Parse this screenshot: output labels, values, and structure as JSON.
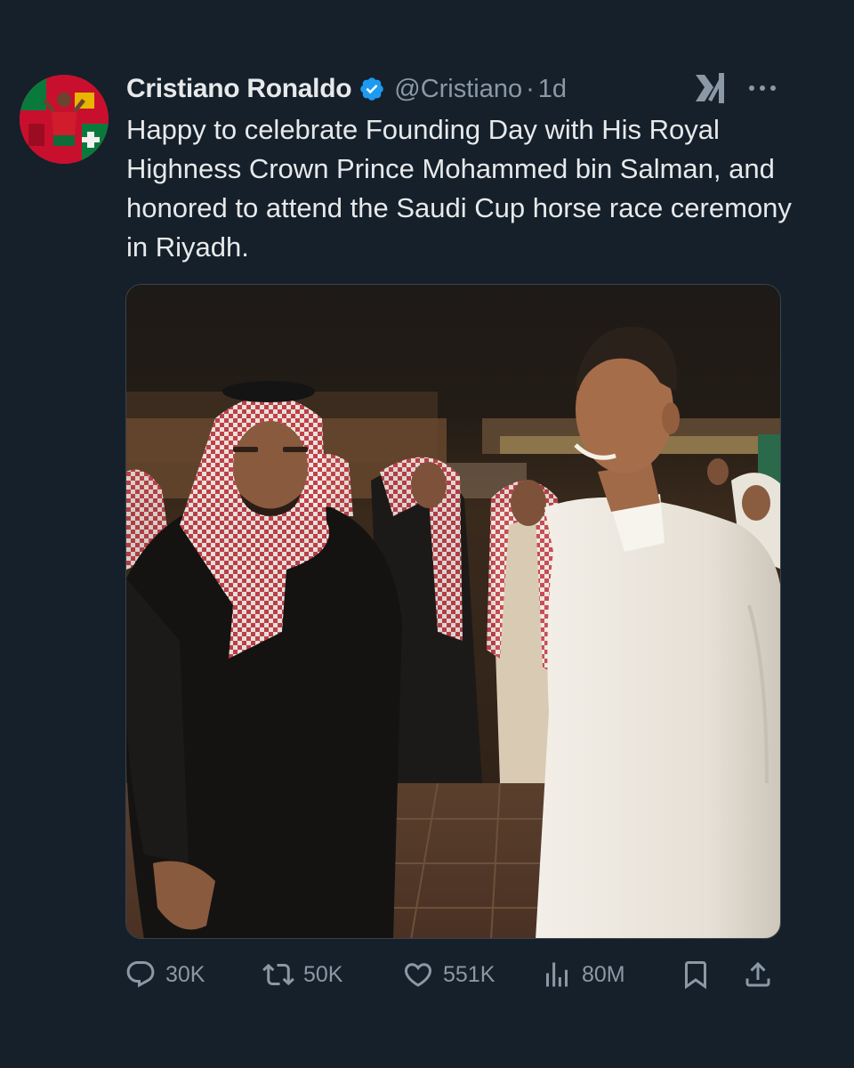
{
  "author": {
    "display_name": "Cristiano Ronaldo",
    "handle": "@Cristiano",
    "separator": "·",
    "time": "1d",
    "verified_icon": "verified-badge-icon",
    "avatar_colors": {
      "primary": "#c8102e",
      "secondary": "#0a7a3c",
      "accent": "#e8b600"
    }
  },
  "tweet": {
    "text": "Happy to celebrate Founding Day with His Royal Highness Crown Prince Mohammed bin Salman, and honored to attend the Saudi Cup horse race ceremony in Riyadh."
  },
  "media": {
    "icon": "photo-image"
  },
  "actions": {
    "reply": {
      "icon": "reply-icon",
      "count": "30K"
    },
    "retweet": {
      "icon": "retweet-icon",
      "count": "50K"
    },
    "like": {
      "icon": "like-icon",
      "count": "551K"
    },
    "views": {
      "icon": "views-icon",
      "count": "80M"
    },
    "bookmark": {
      "icon": "bookmark-icon"
    },
    "share": {
      "icon": "share-icon"
    }
  },
  "header_icons": {
    "grok": "grok-icon",
    "more": "more-icon"
  },
  "colors": {
    "background": "#15202b",
    "text_primary": "#e7e9ea",
    "text_secondary": "#8b98a5",
    "verified_blue": "#1d9bf0",
    "border": "#38444d"
  }
}
